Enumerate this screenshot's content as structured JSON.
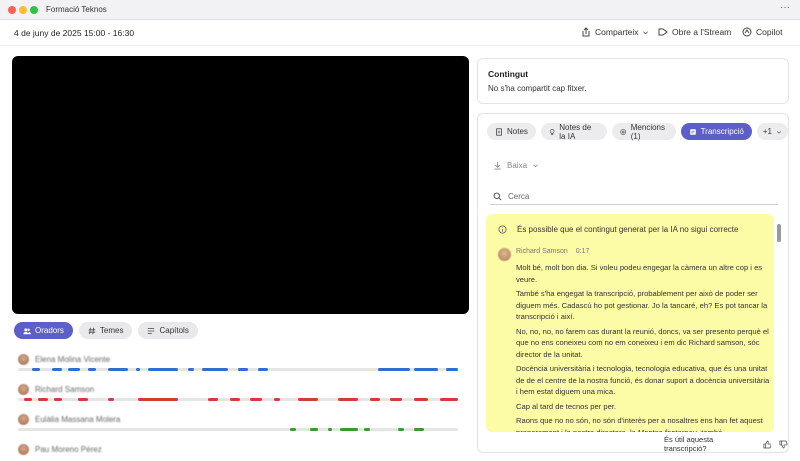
{
  "window": {
    "title": "Formació Teknos",
    "more_label": "···"
  },
  "header": {
    "date": "4 de juny de 2025 15:00 - 16:30",
    "share_label": "Comparteix",
    "stream_label": "Obre a l'Stream",
    "copilot_label": "Copilot"
  },
  "left_tabs": [
    {
      "label": "Oradors",
      "icon": "people-icon"
    },
    {
      "label": "Temes",
      "icon": "hash-icon"
    },
    {
      "label": "Capítols",
      "icon": "list-icon"
    }
  ],
  "speakers": [
    {
      "name": "Elena Molina Vicente",
      "color": "#2f6fd1"
    },
    {
      "name": "Richard Samson",
      "color": "#d23b3b"
    },
    {
      "name": "Eulàlia Massana Molera",
      "color": "#3a9a2f"
    },
    {
      "name": "Pau Moreno Pérez",
      "color": "#555555"
    }
  ],
  "content": {
    "title": "Contingut",
    "message": "No s'ha compartit cap fitxer."
  },
  "right_tabs": [
    {
      "label": "Notes",
      "icon": "notes-icon"
    },
    {
      "label": "Notes de la IA",
      "icon": "ai-icon"
    },
    {
      "label": "Mencions (1)",
      "icon": "at-icon"
    },
    {
      "label": "Transcripció",
      "icon": "transcript-icon"
    },
    {
      "label": "+1",
      "icon": "chevron-down-icon"
    }
  ],
  "download_label": "Baixa",
  "search": {
    "placeholder": "Cerca"
  },
  "transcript": {
    "warning": "És possible que el contingut generat per la IA no sigui correcte",
    "speaker": "Richard Samson",
    "timestamp": "0:17",
    "paragraphs": [
      "Molt bé, molt bon dia. Si voleu podeu engegar la càmera un altre cop i es veure.",
      "També s'ha engegat la transcripció, probablement per això de poder ser diguem més. Cadascú ho pot gestionar. Jo la tancaré, eh? Es pot tancar la transcripció i així.",
      "No, no, no, no farem cas durant la reunió, doncs, va ser presento perquè el que no ens coneixeu com no em coneixeu i em dic Richard samson, sóc director de la unitat.",
      "Docència universitària i tecnologia, tecnologia educativa, que és una unitat de de el centre de la nostra funció, és donar suport a docència universitària i hem estat diguem una mica.",
      "Cap al tard de tecnos per per.",
      "Raons que no no són, no són d'interès per a nosaltres ens han fet aquest properament i la nostra directora, la Montse fontarnau, també"
    ]
  },
  "feedback": {
    "question": "És útil aquesta transcripció?"
  },
  "colors": {
    "accent": "#5b5fc7",
    "highlight": "#fdfca6"
  }
}
